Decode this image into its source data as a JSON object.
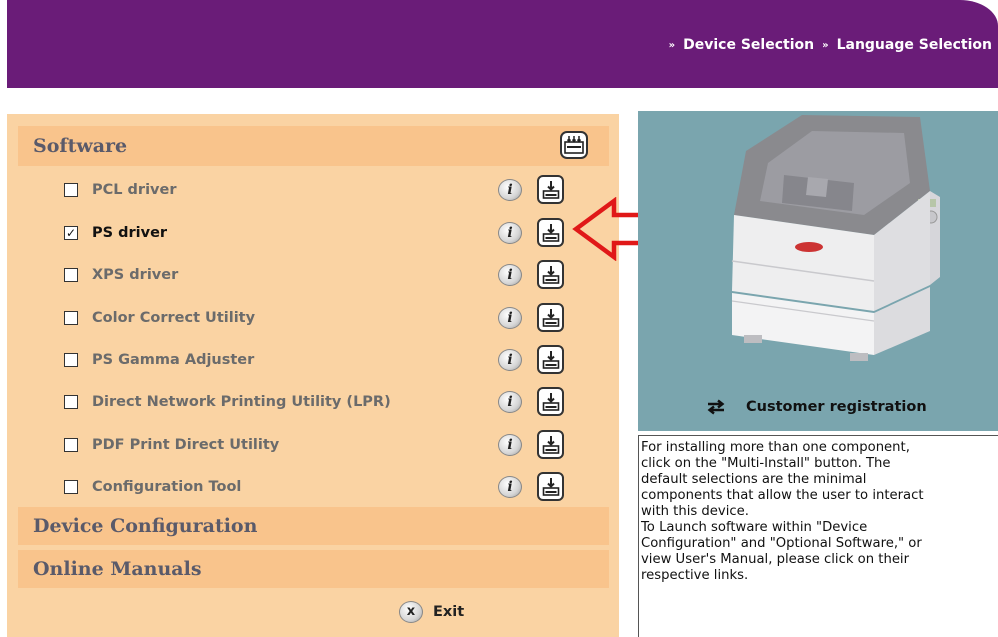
{
  "header": {
    "breadcrumb": [
      {
        "sep": "»",
        "label": "Device Selection"
      },
      {
        "sep": "»",
        "label": "Language Selection"
      }
    ],
    "background_color": "#6a1c78"
  },
  "left_panel": {
    "software_header": "Software",
    "items": [
      {
        "label": "PCL driver",
        "checked": false,
        "check_char": ""
      },
      {
        "label": "PS driver",
        "checked": true,
        "check_char": "✓"
      },
      {
        "label": "XPS driver",
        "checked": false,
        "check_char": ""
      },
      {
        "label": "Color Correct Utility",
        "checked": false,
        "check_char": ""
      },
      {
        "label": "PS Gamma Adjuster",
        "checked": false,
        "check_char": ""
      },
      {
        "label": "Direct Network Printing Utility (LPR)",
        "checked": false,
        "check_char": ""
      },
      {
        "label": "PDF Print Direct Utility",
        "checked": false,
        "check_char": ""
      },
      {
        "label": "Configuration Tool",
        "checked": false,
        "check_char": ""
      }
    ],
    "info_glyph": "i",
    "device_configuration_header": "Device Configuration",
    "online_manuals_header": "Online Manuals",
    "exit_icon": "x",
    "exit_label": "Exit",
    "panel_color": "#fad3a3",
    "section_color": "#f9c48c"
  },
  "right_panel": {
    "customer_registration_label": "Customer registration",
    "panel_color": "#7aa5ae",
    "info_lines": [
      "For installing more than one component,",
      "click on the \"Multi-Install\" button. The",
      "default selections are the minimal",
      "components that allow the user to interact",
      "with this device.",
      "To Launch software within \"Device",
      "Configuration\" and \"Optional Software,\" or",
      "view User's Manual, please click on their",
      "respective links."
    ]
  },
  "annotation_arrow_color": "#e01818"
}
